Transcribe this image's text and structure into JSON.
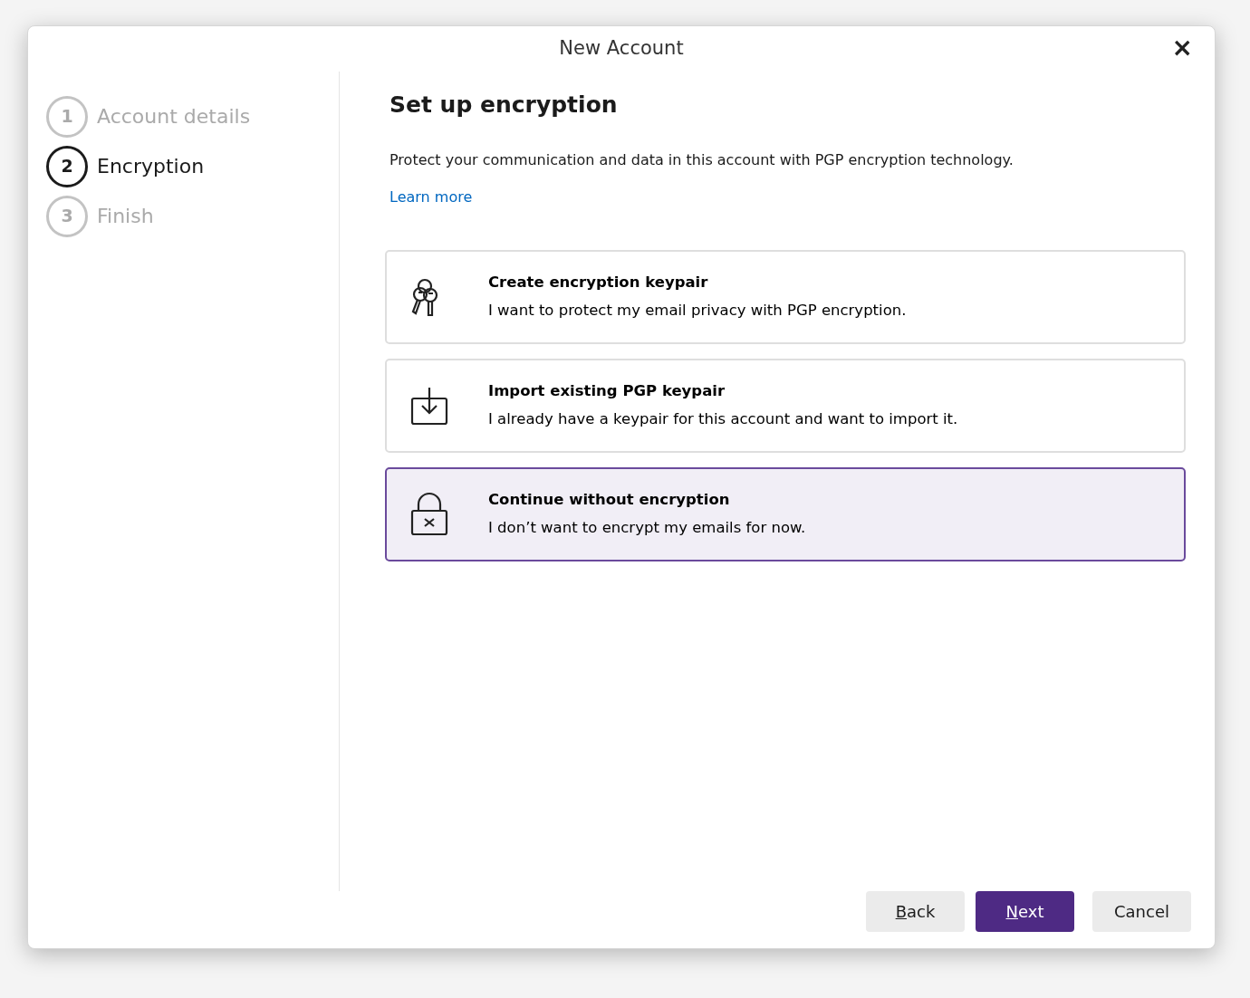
{
  "window": {
    "title": "New Account",
    "close": "×"
  },
  "steps": [
    {
      "number": "1",
      "label": "Account details",
      "selected": false
    },
    {
      "number": "2",
      "label": "Encryption",
      "selected": true
    },
    {
      "number": "3",
      "label": "Finish",
      "selected": false
    }
  ],
  "heading": "Set up encryption",
  "description": "Protect your communication and data in this account with PGP encryption technology.",
  "link": "Learn more",
  "options": [
    {
      "kind": "keys",
      "title": "Create encryption keypair",
      "subtitle": "I want to protect my email privacy with PGP encryption.",
      "selected": false
    },
    {
      "kind": "import",
      "title": "Import existing PGP keypair",
      "subtitle": "I already have a keypair for this account and want to import it.",
      "selected": false
    },
    {
      "kind": "lock",
      "title": "Continue without encryption",
      "subtitle": "I don’t want to encrypt my emails for now.",
      "selected": true
    }
  ],
  "buttons": [
    {
      "kind": "secondary",
      "label": "Back",
      "mnemonic": true
    },
    {
      "kind": "primary",
      "label": "Next",
      "mnemonic": true
    },
    {
      "kind": "secondary",
      "label": "Cancel",
      "mnemonic": false
    }
  ]
}
